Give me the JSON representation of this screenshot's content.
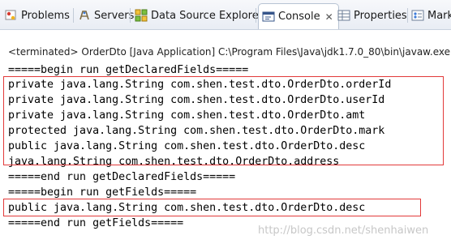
{
  "tabs": [
    {
      "label": "Problems",
      "icon": "problems-icon"
    },
    {
      "label": "Servers",
      "icon": "servers-icon"
    },
    {
      "label": "Data Source Explorer",
      "icon": "data-source-icon"
    },
    {
      "label": "Console",
      "icon": "console-icon",
      "active": true,
      "close": "✕"
    },
    {
      "label": "Properties",
      "icon": "properties-icon"
    },
    {
      "label": "Marke",
      "icon": "markers-icon"
    }
  ],
  "console": {
    "terminated_header": "<terminated> OrderDto [Java Application] C:\\Program Files\\Java\\jdk1.7.0_80\\bin\\javaw.exe (20",
    "lines": [
      "=====begin run getDeclaredFields=====",
      "private java.lang.String com.shen.test.dto.OrderDto.orderId",
      "private java.lang.String com.shen.test.dto.OrderDto.userId",
      "private java.lang.String com.shen.test.dto.OrderDto.amt",
      "protected java.lang.String com.shen.test.dto.OrderDto.mark",
      "public java.lang.String com.shen.test.dto.OrderDto.desc",
      "java.lang.String com.shen.test.dto.OrderDto.address",
      "=====end run getDeclaredFields=====",
      "=====begin run getFields=====",
      "public java.lang.String com.shen.test.dto.OrderDto.desc",
      "=====end run getFields====="
    ]
  },
  "watermark": "http://blog.csdn.net/shenhaiwen",
  "colors": {
    "highlight_box": "#e23a3a",
    "active_tab": "#ffffff",
    "tabbar": "#e9edf4"
  }
}
